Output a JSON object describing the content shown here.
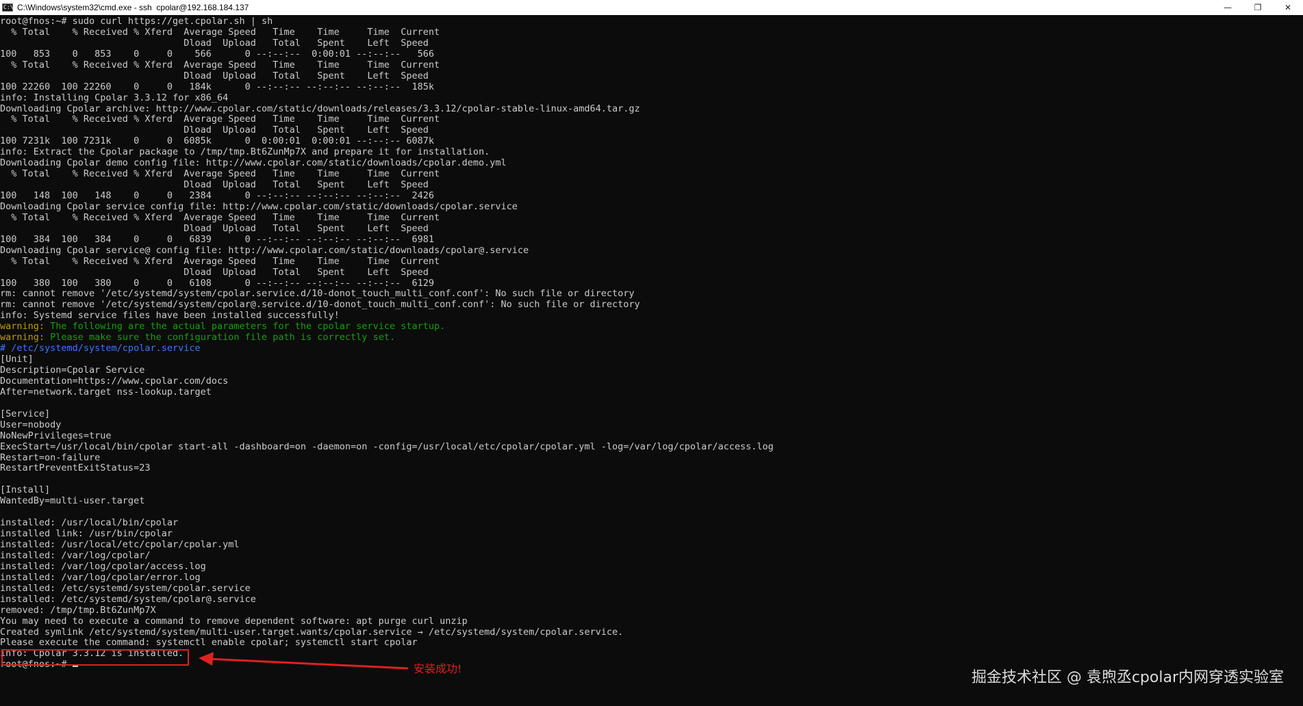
{
  "window": {
    "title": "C:\\Windows\\system32\\cmd.exe - ssh  cpolar@192.168.184.137",
    "icon": "cmd-icon",
    "controls": {
      "minimize": "—",
      "restore": "❐",
      "close": "✕"
    }
  },
  "terminal": {
    "lines": [
      {
        "text": "root@fnos:~# sudo curl https://get.cpolar.sh | sh"
      },
      {
        "text": "  % Total    % Received % Xferd  Average Speed   Time    Time     Time  Current"
      },
      {
        "text": "                                 Dload  Upload   Total   Spent    Left  Speed"
      },
      {
        "text": "100   853    0   853    0     0    566      0 --:--:--  0:00:01 --:--:--   566"
      },
      {
        "text": "  % Total    % Received % Xferd  Average Speed   Time    Time     Time  Current"
      },
      {
        "text": "                                 Dload  Upload   Total   Spent    Left  Speed"
      },
      {
        "text": "100 22260  100 22260    0     0   184k      0 --:--:-- --:--:-- --:--:--  185k"
      },
      {
        "text": "info: Installing Cpolar 3.3.12 for x86_64"
      },
      {
        "text": "Downloading Cpolar archive: http://www.cpolar.com/static/downloads/releases/3.3.12/cpolar-stable-linux-amd64.tar.gz"
      },
      {
        "text": "  % Total    % Received % Xferd  Average Speed   Time    Time     Time  Current"
      },
      {
        "text": "                                 Dload  Upload   Total   Spent    Left  Speed"
      },
      {
        "text": "100 7231k  100 7231k    0     0  6085k      0  0:00:01  0:00:01 --:--:-- 6087k"
      },
      {
        "text": "info: Extract the Cpolar package to /tmp/tmp.Bt6ZunMp7X and prepare it for installation."
      },
      {
        "text": "Downloading Cpolar demo config file: http://www.cpolar.com/static/downloads/cpolar.demo.yml"
      },
      {
        "text": "  % Total    % Received % Xferd  Average Speed   Time    Time     Time  Current"
      },
      {
        "text": "                                 Dload  Upload   Total   Spent    Left  Speed"
      },
      {
        "text": "100   148  100   148    0     0   2384      0 --:--:-- --:--:-- --:--:--  2426"
      },
      {
        "text": "Downloading Cpolar service config file: http://www.cpolar.com/static/downloads/cpolar.service"
      },
      {
        "text": "  % Total    % Received % Xferd  Average Speed   Time    Time     Time  Current"
      },
      {
        "text": "                                 Dload  Upload   Total   Spent    Left  Speed"
      },
      {
        "text": "100   384  100   384    0     0   6839      0 --:--:-- --:--:-- --:--:--  6981"
      },
      {
        "text": "Downloading Cpolar service@ config file: http://www.cpolar.com/static/downloads/cpolar@.service"
      },
      {
        "text": "  % Total    % Received % Xferd  Average Speed   Time    Time     Time  Current"
      },
      {
        "text": "                                 Dload  Upload   Total   Spent    Left  Speed"
      },
      {
        "text": "100   380  100   380    0     0   6108      0 --:--:-- --:--:-- --:--:--  6129"
      },
      {
        "text": "rm: cannot remove '/etc/systemd/system/cpolar.service.d/10-donot_touch_multi_conf.conf': No such file or directory"
      },
      {
        "text": "rm: cannot remove '/etc/systemd/system/cpolar@.service.d/10-donot_touch_multi_conf.conf': No such file or directory"
      },
      {
        "text": "info: Systemd service files have been installed successfully!"
      },
      {
        "type": "warning",
        "label": "warning:",
        "text": " The following are the actual parameters for the cpolar service startup."
      },
      {
        "type": "warning",
        "label": "warning:",
        "text": " Please make sure the configuration file path is correctly set."
      },
      {
        "type": "comment",
        "text": "# /etc/systemd/system/cpolar.service"
      },
      {
        "text": "[Unit]"
      },
      {
        "text": "Description=Cpolar Service"
      },
      {
        "text": "Documentation=https://www.cpolar.com/docs"
      },
      {
        "text": "After=network.target nss-lookup.target"
      },
      {
        "text": ""
      },
      {
        "text": "[Service]"
      },
      {
        "text": "User=nobody"
      },
      {
        "text": "NoNewPrivileges=true"
      },
      {
        "text": "ExecStart=/usr/local/bin/cpolar start-all -dashboard=on -daemon=on -config=/usr/local/etc/cpolar/cpolar.yml -log=/var/log/cpolar/access.log"
      },
      {
        "text": "Restart=on-failure"
      },
      {
        "text": "RestartPreventExitStatus=23"
      },
      {
        "text": ""
      },
      {
        "text": "[Install]"
      },
      {
        "text": "WantedBy=multi-user.target"
      },
      {
        "text": ""
      },
      {
        "text": "installed: /usr/local/bin/cpolar"
      },
      {
        "text": "installed link: /usr/bin/cpolar"
      },
      {
        "text": "installed: /usr/local/etc/cpolar/cpolar.yml"
      },
      {
        "text": "installed: /var/log/cpolar/"
      },
      {
        "text": "installed: /var/log/cpolar/access.log"
      },
      {
        "text": "installed: /var/log/cpolar/error.log"
      },
      {
        "text": "installed: /etc/systemd/system/cpolar.service"
      },
      {
        "text": "installed: /etc/systemd/system/cpolar@.service"
      },
      {
        "text": "removed: /tmp/tmp.Bt6ZunMp7X"
      },
      {
        "text": "You may need to execute a command to remove dependent software: apt purge curl unzip"
      },
      {
        "text": "Created symlink /etc/systemd/system/multi-user.target.wants/cpolar.service → /etc/systemd/system/cpolar.service."
      },
      {
        "text": "Please execute the command: systemctl enable cpolar; systemctl start cpolar"
      },
      {
        "text": "info: Cpolar 3.3.12 is installed."
      },
      {
        "type": "prompt",
        "text": "root@fnos:~# "
      }
    ]
  },
  "annotation": {
    "text": "安装成功!",
    "color": "#e02020"
  },
  "watermark": {
    "text": "掘金技术社区 @ 袁煦丞cpolar内网穿透实验室"
  }
}
